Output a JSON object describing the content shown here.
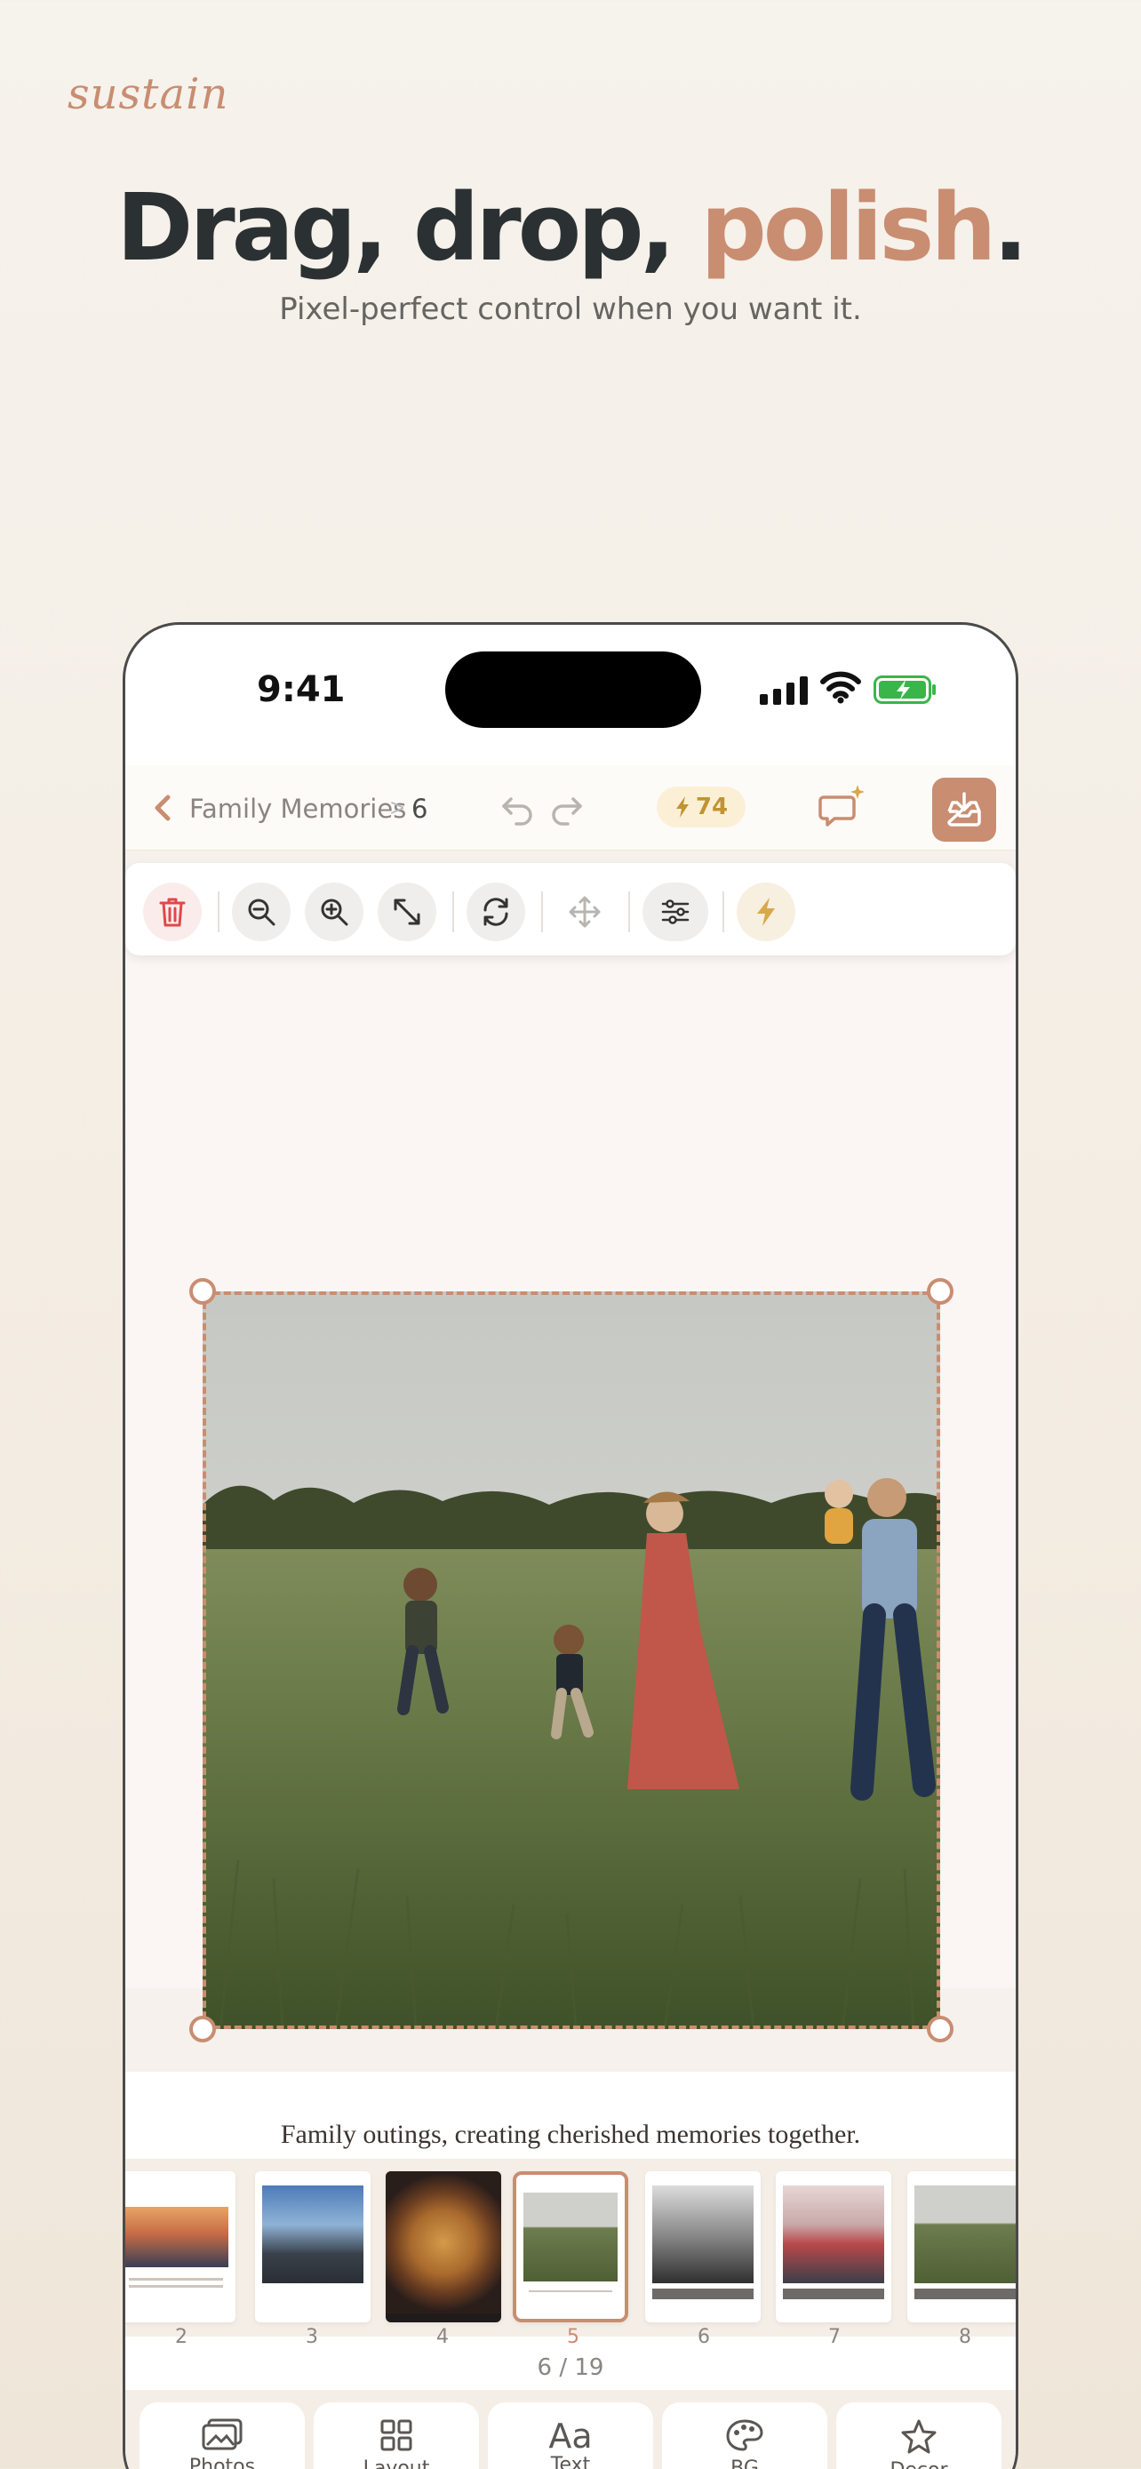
{
  "brand": "sustain",
  "headline": {
    "part1": "Drag, drop, ",
    "accent": "polish",
    "end": "."
  },
  "subheadline": "Pixel-perfect control when you want it.",
  "status_bar": {
    "time": "9:41"
  },
  "nav": {
    "breadcrumb": "Family Memories",
    "separator": ">",
    "page": "6",
    "credits": "74"
  },
  "toolbar": {
    "icons": [
      "trash-icon",
      "zoom-out-icon",
      "zoom-in-icon",
      "expand-icon",
      "rotate-icon",
      "move-icon",
      "adjust-icon",
      "boost-icon"
    ]
  },
  "canvas": {
    "caption": "Family outings, creating cherished memories together."
  },
  "filmstrip": {
    "pages": [
      {
        "number": "2",
        "active": false
      },
      {
        "number": "3",
        "active": false
      },
      {
        "number": "4",
        "active": false
      },
      {
        "number": "5",
        "active": true
      },
      {
        "number": "6",
        "active": false
      },
      {
        "number": "7",
        "active": false
      },
      {
        "number": "8",
        "active": false
      }
    ],
    "pager": "6 / 19"
  },
  "tabs": [
    {
      "label": "Photos",
      "icon": "photos-icon"
    },
    {
      "label": "Layout",
      "icon": "grid-icon"
    },
    {
      "label": "Text",
      "icon": "text-icon",
      "glyph": "Aa"
    },
    {
      "label": "BG",
      "icon": "palette-icon"
    },
    {
      "label": "Decor",
      "icon": "star-icon"
    }
  ],
  "colors": {
    "accent": "#c98d71",
    "dark": "#2b3133",
    "credit": "#c09432"
  }
}
